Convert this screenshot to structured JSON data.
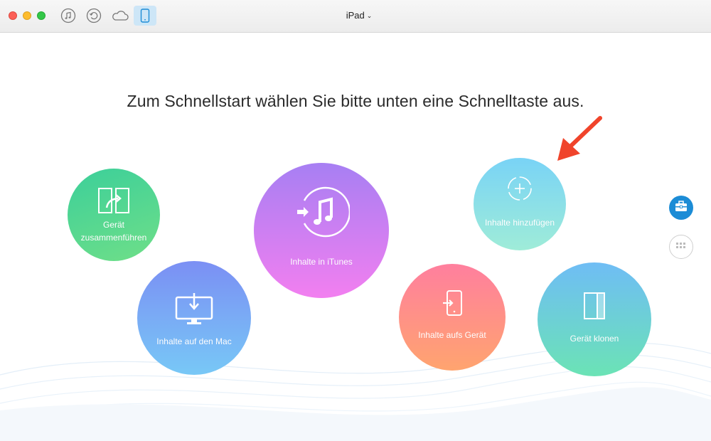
{
  "window": {
    "device_title": "iPad"
  },
  "toolbar": {
    "icons": [
      "music-note-icon",
      "restore-icon",
      "cloud-icon",
      "device-icon"
    ]
  },
  "main": {
    "headline": "Zum Schnellstart wählen Sie bitte unten eine Schnelltaste aus.",
    "actions": [
      {
        "label_line1": "Gerät",
        "label_line2": "zusammenführen",
        "icon": "merge-devices-icon"
      },
      {
        "label": "Inhalte auf den Mac",
        "icon": "monitor-download-icon"
      },
      {
        "label": "Inhalte in iTunes",
        "icon": "itunes-transfer-icon"
      },
      {
        "label": "Inhalte hinzufügen",
        "icon": "add-content-icon"
      },
      {
        "label": "Inhalte aufs Gerät",
        "icon": "device-import-icon"
      },
      {
        "label": "Gerät klonen",
        "icon": "clone-device-icon"
      }
    ]
  },
  "sidebar": {
    "buttons": [
      "toolkit-icon",
      "grid-icon"
    ]
  },
  "colors": {
    "accent_blue": "#1c8cd6",
    "arrow_red": "#f0442b"
  }
}
